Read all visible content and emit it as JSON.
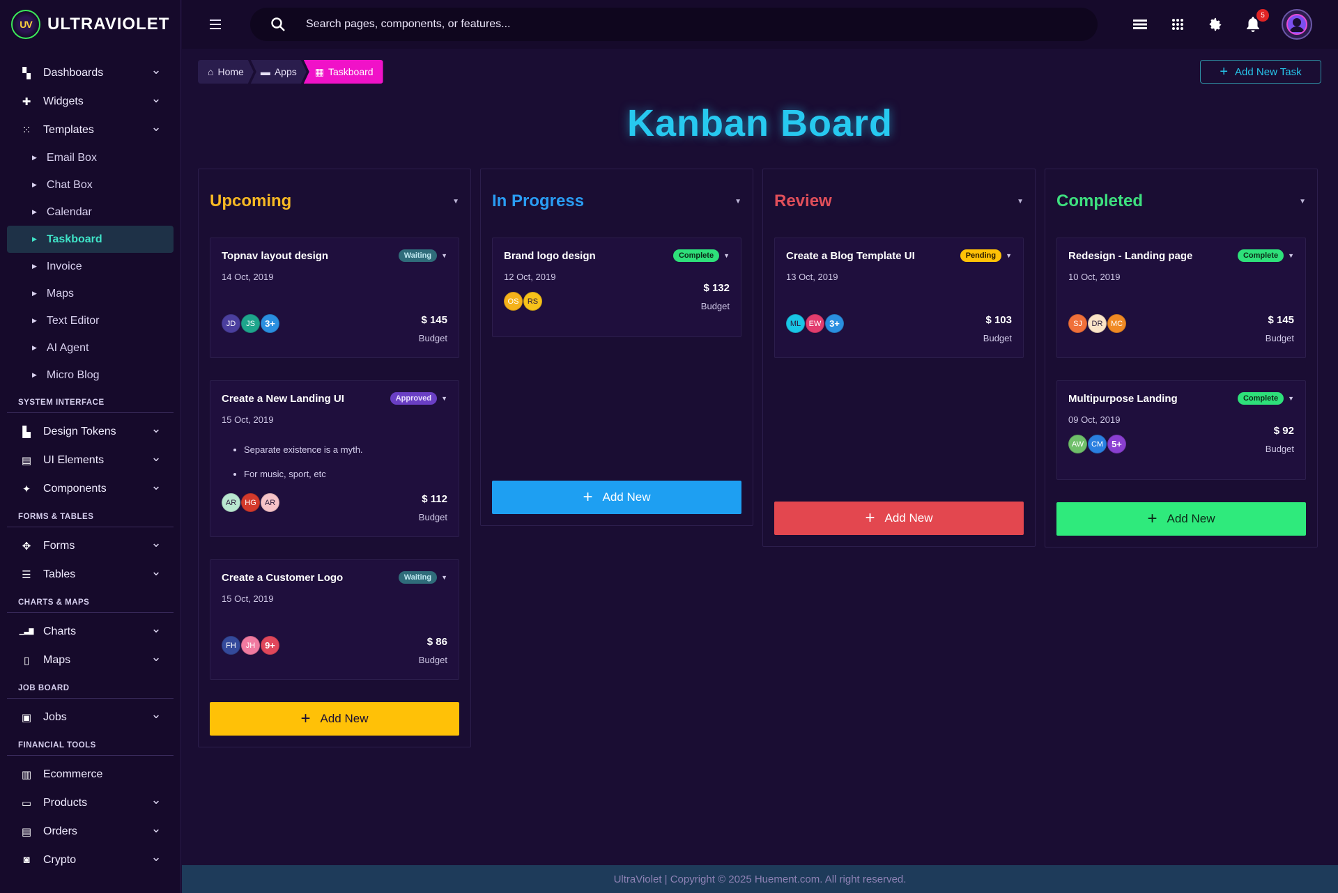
{
  "app": {
    "brand_logo_text": "UV",
    "brand_name": "ULTRAVIOLET"
  },
  "sidebar": {
    "groups": [
      {
        "items": [
          {
            "label": "Dashboards",
            "icon": "dashboard-icon"
          },
          {
            "label": "Widgets",
            "icon": "widgets-icon"
          },
          {
            "label": "Templates",
            "icon": "apps-grid-icon"
          }
        ]
      }
    ],
    "template_sub_items": [
      "Email Box",
      "Chat Box",
      "Calendar",
      "Taskboard",
      "Invoice",
      "Maps",
      "Text Editor",
      "AI Agent",
      "Micro Blog"
    ],
    "active_sub_item": "Taskboard",
    "sections": [
      {
        "title": "SYSTEM INTERFACE",
        "items": [
          {
            "label": "Design Tokens",
            "icon": "paint-roller-icon",
            "chevron": true
          },
          {
            "label": "UI Elements",
            "icon": "ui-elements-icon",
            "chevron": true
          },
          {
            "label": "Components",
            "icon": "puzzle-icon",
            "chevron": true
          }
        ]
      },
      {
        "title": "FORMS & TABLES",
        "items": [
          {
            "label": "Forms",
            "icon": "forms-icon",
            "chevron": true
          },
          {
            "label": "Tables",
            "icon": "list-icon",
            "chevron": true
          }
        ]
      },
      {
        "title": "CHARTS & MAPS",
        "items": [
          {
            "label": "Charts",
            "icon": "bar-chart-icon",
            "chevron": true
          },
          {
            "label": "Maps",
            "icon": "map-icon",
            "chevron": true
          }
        ]
      },
      {
        "title": "JOB BOARD",
        "items": [
          {
            "label": "Jobs",
            "icon": "briefcase-icon",
            "chevron": true
          }
        ]
      },
      {
        "title": "FINANCIAL TOOLS",
        "items": [
          {
            "label": "Ecommerce",
            "icon": "store-icon",
            "chevron": false
          },
          {
            "label": "Products",
            "icon": "clipboard-icon",
            "chevron": true
          },
          {
            "label": "Orders",
            "icon": "receipt-icon",
            "chevron": true
          },
          {
            "label": "Crypto",
            "icon": "crypto-icon",
            "chevron": true
          }
        ]
      }
    ]
  },
  "topbar": {
    "search_placeholder": "Search pages, components, or features...",
    "notification_count": "5"
  },
  "breadcrumb": [
    {
      "label": "Home",
      "icon": "home-icon"
    },
    {
      "label": "Apps",
      "icon": "folder-icon"
    },
    {
      "label": "Taskboard",
      "icon": "grid-icon"
    }
  ],
  "add_task_label": "Add New Task",
  "page_title": "Kanban Board",
  "columns": [
    {
      "title": "Upcoming",
      "color": "#f7b924",
      "btn_bg": "#ffc107",
      "btn_fg": "#1a0d33",
      "add_label": "Add New",
      "cards": [
        {
          "title": "Topnav layout design",
          "date": "14 Oct, 2019",
          "status": "Waiting",
          "status_bg": "#2f6c7a",
          "status_fg": "#bfe8f0",
          "avatars": [
            {
              "t": "JD",
              "c": "#4b3f9e"
            },
            {
              "t": "JS",
              "c": "#1ea58c"
            },
            {
              "t": "3+",
              "c": "#2a8fe0",
              "more": true
            }
          ],
          "budget": "$ 145",
          "budget_label": "Budget"
        },
        {
          "title": "Create a New Landing UI",
          "date": "15 Oct, 2019",
          "status": "Approved",
          "status_bg": "#6a3fc4",
          "status_fg": "#e8defc",
          "bullets": [
            "Separate existence is a myth.",
            "For music, sport, etc"
          ],
          "avatars": [
            {
              "t": "AR",
              "c": "#b9e6d0",
              "dark": true
            },
            {
              "t": "HG",
              "c": "#d33a2c"
            },
            {
              "t": "AR",
              "c": "#f6c3c8",
              "dark": true
            }
          ],
          "budget": "$ 112",
          "budget_label": "Budget"
        },
        {
          "title": "Create a Customer Logo",
          "date": "15 Oct, 2019",
          "status": "Waiting",
          "status_bg": "#2f6c7a",
          "status_fg": "#bfe8f0",
          "avatars": [
            {
              "t": "FH",
              "c": "#344a9b"
            },
            {
              "t": "JH",
              "c": "#f07aa0"
            },
            {
              "t": "9+",
              "c": "#e0475b",
              "more": true
            }
          ],
          "budget": "$ 86",
          "budget_label": "Budget"
        }
      ]
    },
    {
      "title": "In Progress",
      "color": "#2a9df4",
      "btn_bg": "#1e9ff2",
      "btn_fg": "#ffffff",
      "add_label": "Add New",
      "cards": [
        {
          "title": "Brand logo design",
          "date": "12 Oct, 2019",
          "status": "Complete",
          "status_bg": "#2ee07a",
          "status_fg": "#0c2a18",
          "avatars": [
            {
              "t": "OS",
              "c": "#f5b21b"
            },
            {
              "t": "RS",
              "c": "#f7c21a",
              "dark": true
            }
          ],
          "budget": "$ 132",
          "budget_label": "Budget",
          "compact": true
        }
      ]
    },
    {
      "title": "Review",
      "color": "#e14f5a",
      "btn_bg": "#e3474f",
      "btn_fg": "#ffffff",
      "add_label": "Add New",
      "cards": [
        {
          "title": "Create a Blog Template UI",
          "date": "13 Oct, 2019",
          "status": "Pending",
          "status_bg": "#ffc107",
          "status_fg": "#2a1a00",
          "avatars": [
            {
              "t": "ML",
              "c": "#19c6e6",
              "dark": true
            },
            {
              "t": "EW",
              "c": "#e23d6e"
            },
            {
              "t": "3+",
              "c": "#2a8fe0",
              "more": true
            }
          ],
          "budget": "$ 103",
          "budget_label": "Budget"
        }
      ]
    },
    {
      "title": "Completed",
      "color": "#3ee07f",
      "btn_bg": "#2fea7c",
      "btn_fg": "#0c2a18",
      "add_label": "Add New",
      "cards": [
        {
          "title": "Redesign - Landing page",
          "date": "10 Oct, 2019",
          "status": "Complete",
          "status_bg": "#2ee07a",
          "status_fg": "#0c2a18",
          "avatars": [
            {
              "t": "SJ",
              "c": "#f0703a"
            },
            {
              "t": "DR",
              "c": "#fbe4c8",
              "dark": true
            },
            {
              "t": "MC",
              "c": "#f08a24"
            }
          ],
          "budget": "$ 145",
          "budget_label": "Budget"
        },
        {
          "title": "Multipurpose Landing",
          "date": "09 Oct, 2019",
          "status": "Complete",
          "status_bg": "#2ee07a",
          "status_fg": "#0c2a18",
          "avatars": [
            {
              "t": "AW",
              "c": "#6fbf6a"
            },
            {
              "t": "CM",
              "c": "#2a7fe0"
            },
            {
              "t": "5+",
              "c": "#8a3fd1",
              "more": true
            }
          ],
          "budget": "$ 92",
          "budget_label": "Budget",
          "compact": true
        }
      ]
    }
  ],
  "footer_text": "UltraViolet | Copyright © 2025 Huement.com. All right reserved."
}
